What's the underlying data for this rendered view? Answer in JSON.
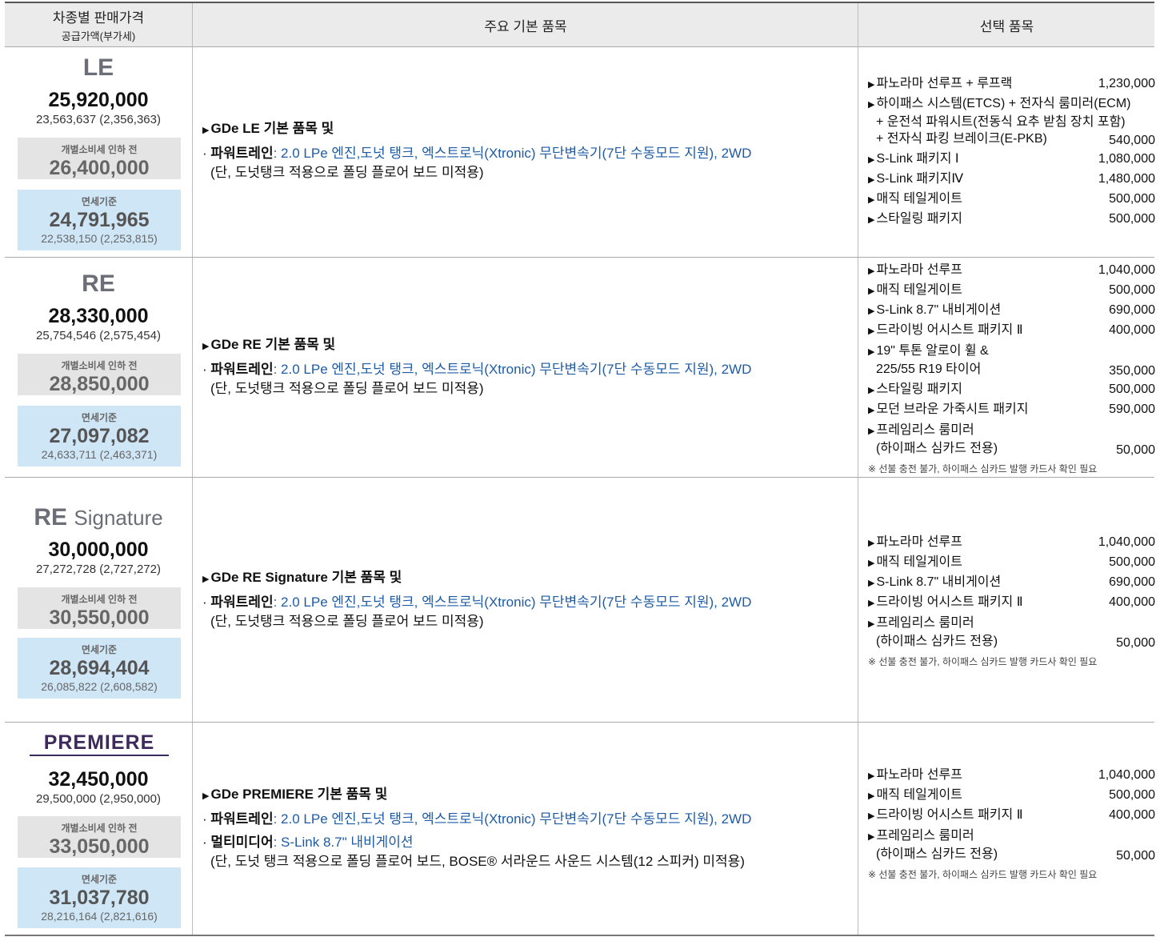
{
  "header": {
    "col1_title": "차종별 판매가격",
    "col1_sub": "공급가액(부가세)",
    "col2_title": "주요 기본 품목",
    "col3_title": "선택 품목"
  },
  "labels": {
    "pre_tax": "개별소비세 인하 전",
    "tax_free": "면세기준",
    "powertrain_label": "파워트레인",
    "multimedia_label": "멀티미디어",
    "powertrain_value": ": 2.0 LPe 엔진,도넛  탱크, 엑스트로닉(Xtronic) 무단변속기(7단 수동모드 지원), 2WD",
    "note_card": "※ 선불 충전 불가, 하이패스 심카드 발행 카드사 확인 필요"
  },
  "trims": [
    {
      "name": "LE",
      "price": "25,920,000",
      "supply": "23,563,637 (2,356,363)",
      "pre_tax_price": "26,400,000",
      "tax_free_price": "24,791,965",
      "tax_free_supply": "22,538,150 (2,253,815)",
      "main_title": "GDe LE 기본 품목 및",
      "main_note": "(단, 도넛탱크 적용으로 폴딩 플로어 보드 미적용)",
      "options": [
        {
          "name": "파노라마 선루프 + 루프랙",
          "price": "1,230,000"
        },
        {
          "name": "하이패스 시스템(ETCS) + 전자식 룸미러(ECM)",
          "line2": "+ 운전석 파워시트(전동식 요추 받침 장치 포함)",
          "line3": "+ 전자식 파킹 브레이크(E-PKB)",
          "price": "540,000"
        },
        {
          "name": "S-Link 패키지 Ⅰ",
          "price": "1,080,000"
        },
        {
          "name": "S-Link 패키지Ⅳ",
          "price": "1,480,000"
        },
        {
          "name": "매직 테일게이트",
          "price": "500,000"
        },
        {
          "name": "스타일링 패키지",
          "price": "500,000"
        }
      ]
    },
    {
      "name": "RE",
      "price": "28,330,000",
      "supply": "25,754,546 (2,575,454)",
      "pre_tax_price": "28,850,000",
      "tax_free_price": "27,097,082",
      "tax_free_supply": "24,633,711 (2,463,371)",
      "main_title": "GDe RE 기본 품목 및",
      "main_note": "(단, 도넛탱크 적용으로 폴딩 플로어 보드 미적용)",
      "options": [
        {
          "name": "파노라마 선루프",
          "price": "1,040,000"
        },
        {
          "name": "매직 테일게이트",
          "price": "500,000"
        },
        {
          "name": "S-Link 8.7\" 내비게이션",
          "price": "690,000"
        },
        {
          "name": "드라이빙 어시스트 패키지 Ⅱ",
          "price": "400,000"
        },
        {
          "name": "19\" 투톤 알로이 휠 &",
          "line2": "225/55 R19 타이어",
          "price": "350,000"
        },
        {
          "name": "스타일링 패키지",
          "price": "500,000"
        },
        {
          "name": "모던 브라운 가죽시트 패키지",
          "price": "590,000"
        },
        {
          "name": "프레임리스 룸미러",
          "line2": "(하이패스 심카드 전용)",
          "price": "50,000"
        }
      ]
    },
    {
      "name": "RE",
      "name_suffix": "Signature",
      "price": "30,000,000",
      "supply": "27,272,728 (2,727,272)",
      "pre_tax_price": "30,550,000",
      "tax_free_price": "28,694,404",
      "tax_free_supply": "26,085,822 (2,608,582)",
      "main_title": "GDe RE Signature 기본 품목 및",
      "main_note": "(단, 도넛탱크 적용으로 폴딩 플로어 보드 미적용)",
      "options": [
        {
          "name": "파노라마 선루프",
          "price": "1,040,000"
        },
        {
          "name": "매직 테일게이트",
          "price": "500,000"
        },
        {
          "name": "S-Link 8.7\" 내비게이션",
          "price": "690,000"
        },
        {
          "name": "드라이빙 어시스트 패키지 Ⅱ",
          "price": "400,000"
        },
        {
          "name": "프레임리스 룸미러",
          "line2": "(하이패스 심카드 전용)",
          "price": "50,000"
        }
      ]
    },
    {
      "name": "PREMIERE",
      "price": "32,450,000",
      "supply": "29,500,000 (2,950,000)",
      "pre_tax_price": "33,050,000",
      "tax_free_price": "31,037,780",
      "tax_free_supply": "28,216,164 (2,821,616)",
      "main_title": "GDe PREMIERE 기본 품목 및",
      "multimedia_value": ": S-Link 8.7\" 내비게이션",
      "main_note": "(단, 도넛 탱크 적용으로 폴딩 플로어 보드, BOSE® 서라운드 사운드 시스템(12 스피커) 미적용)",
      "options": [
        {
          "name": "파노라마 선루프",
          "price": "1,040,000"
        },
        {
          "name": "매직 테일게이트",
          "price": "500,000"
        },
        {
          "name": "드라이빙 어시스트 패키지 Ⅱ",
          "price": "400,000"
        },
        {
          "name": "프레임리스 룸미러",
          "line2": "(하이패스 심카드 전용)",
          "price": "50,000"
        }
      ]
    }
  ],
  "colors": {
    "blue_text": "#1e5ba6",
    "tax_free_bg": "#cfe6f7",
    "pre_tax_bg": "#e4e4e4",
    "logo": "#3d2a5c"
  }
}
